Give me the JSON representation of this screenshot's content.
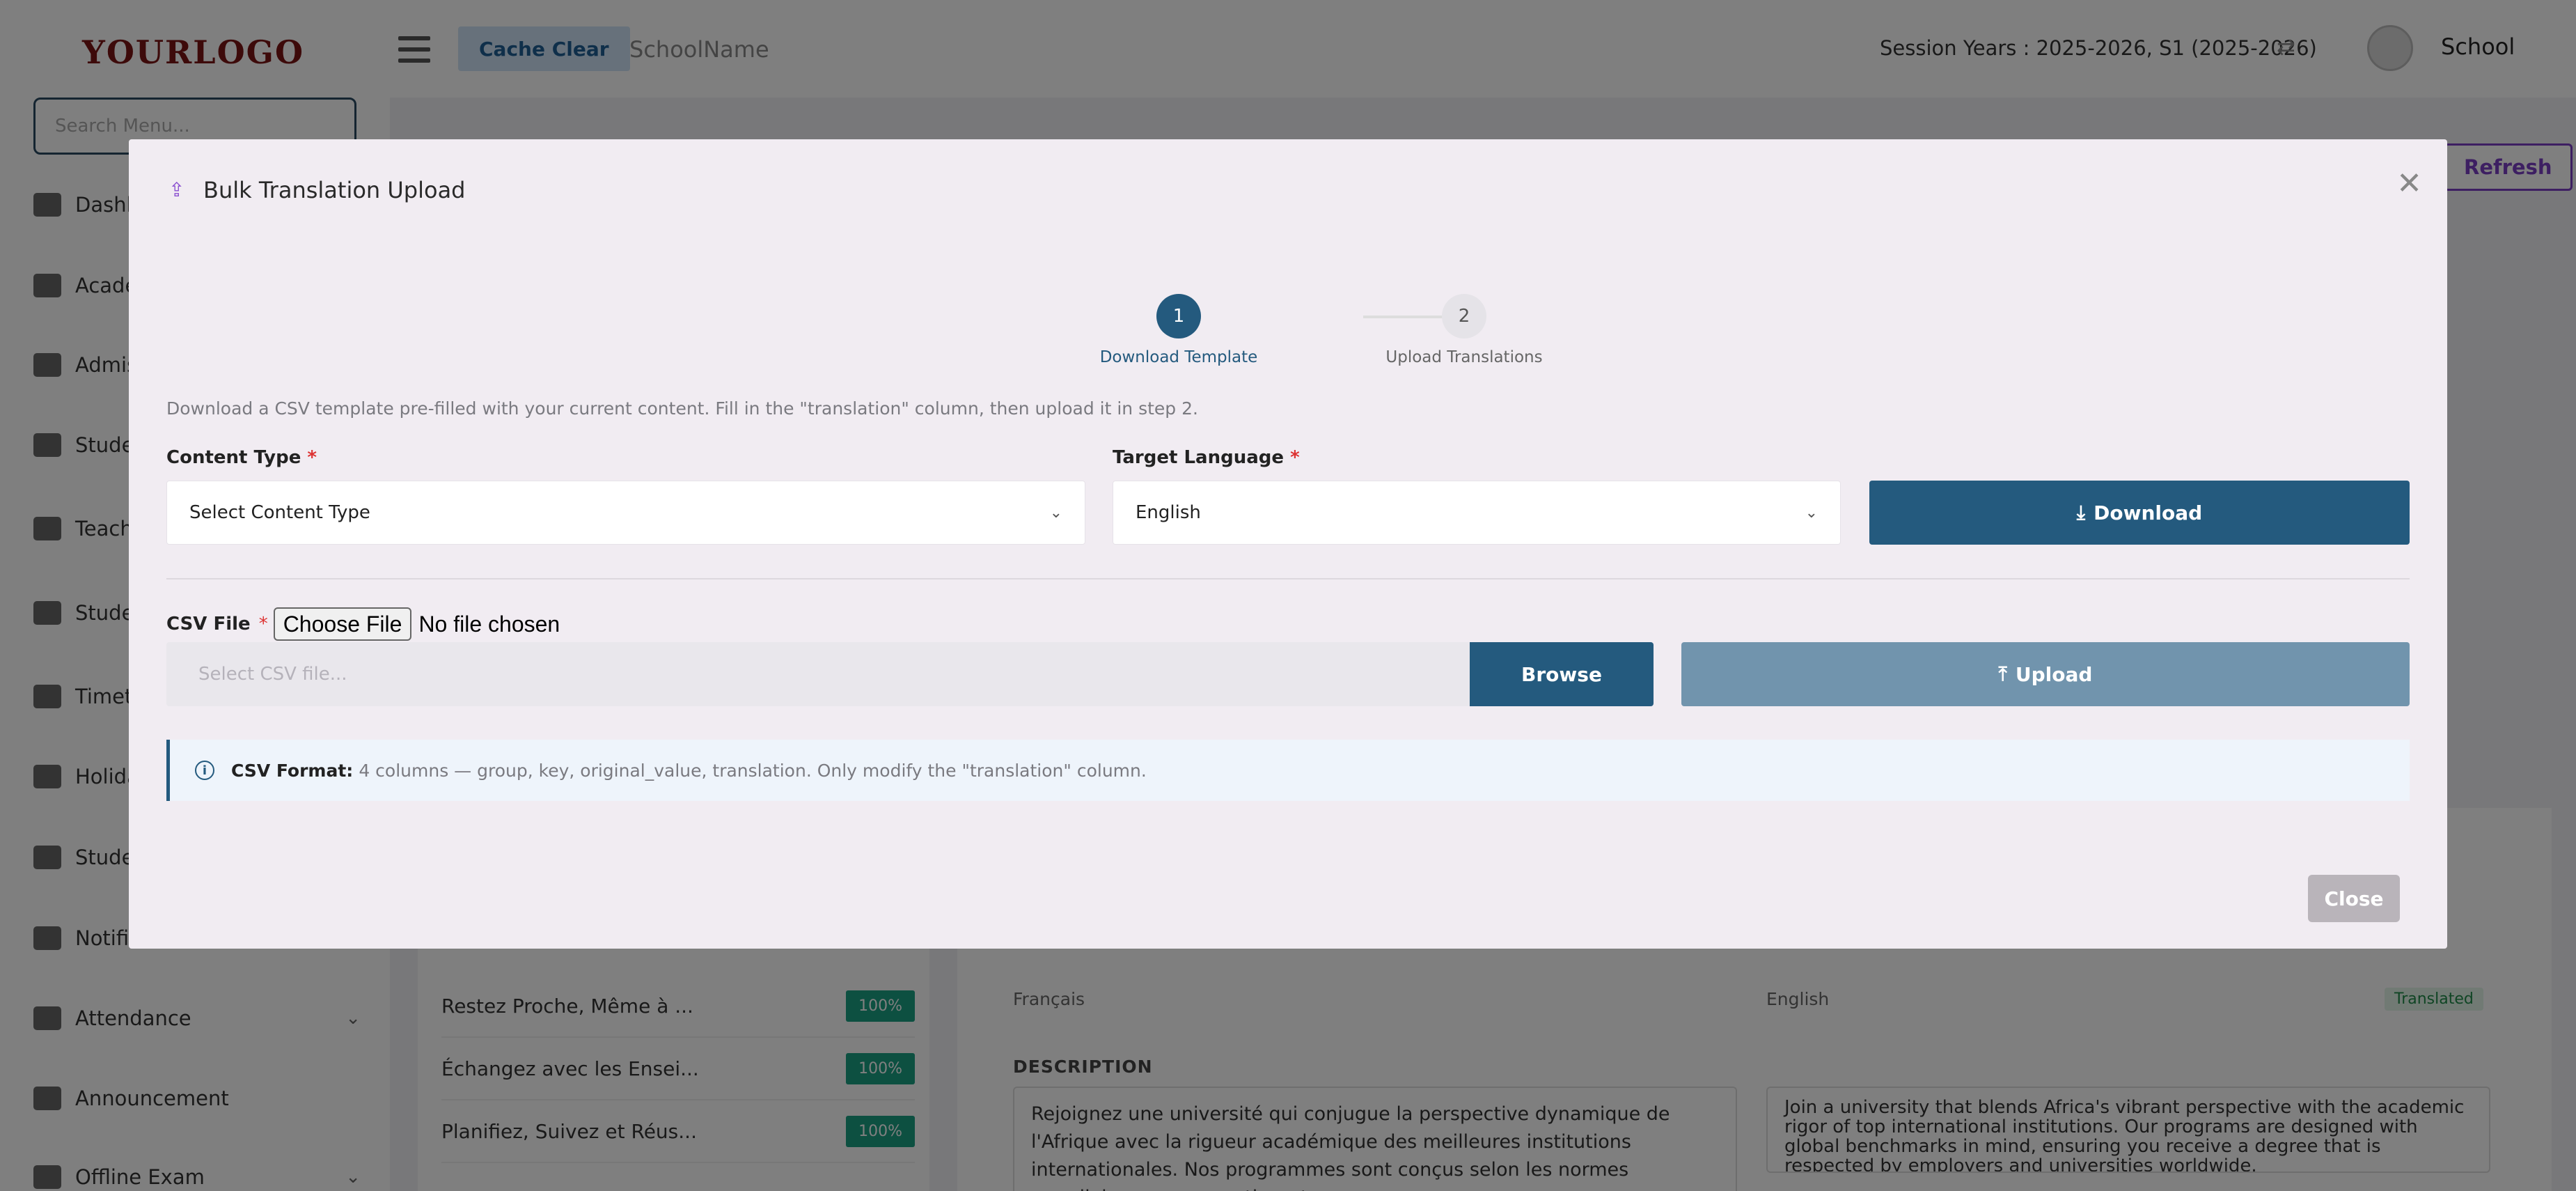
{
  "header": {
    "logo": "YOURLOGO",
    "cache_clear": "Cache Clear",
    "school_name": "SchoolName",
    "session": "Session Years : 2025-2026, S1 (2025-2026)",
    "user": "School"
  },
  "sidebar": {
    "search_placeholder": "Search Menu...",
    "items": [
      {
        "label": "Dashb"
      },
      {
        "label": "Acade"
      },
      {
        "label": "Admis"
      },
      {
        "label": "Stude"
      },
      {
        "label": "Teach"
      },
      {
        "label": "Stude"
      },
      {
        "label": "Timet"
      },
      {
        "label": "Holida"
      },
      {
        "label": "Stude"
      },
      {
        "label": "Notifi"
      },
      {
        "label": "Attendance"
      },
      {
        "label": "Announcement"
      },
      {
        "label": "Offline Exam"
      }
    ]
  },
  "background": {
    "refresh": "Refresh",
    "translated": "Translated",
    "list": [
      {
        "title": "Restez Proche, Même à ...",
        "pct": "100%"
      },
      {
        "title": "Échangez avec les Ensei...",
        "pct": "100%"
      },
      {
        "title": "Planifiez, Suivez et Réus...",
        "pct": "100%"
      }
    ],
    "lang_fr": "Français",
    "lang_en": "English",
    "description_label": "DESCRIPTION",
    "desc_fr": "Rejoignez une université qui conjugue la perspective dynamique de l'Afrique avec la rigueur académique des meilleures institutions internationales. Nos programmes sont conçus selon les normes mondiales, vous garantissant un",
    "desc_en": "Join a university that blends Africa's vibrant perspective with the academic rigor of top international institutions. Our programs are designed with global benchmarks in mind, ensuring you receive a degree that is respected by employers and universities worldwide."
  },
  "modal": {
    "title": "Bulk Translation Upload",
    "steps": [
      {
        "number": "1",
        "label": "Download Template"
      },
      {
        "number": "2",
        "label": "Upload Translations"
      }
    ],
    "instruction": "Download a CSV template pre-filled with your current content. Fill in the \"translation\" column, then upload it in step 2.",
    "content_type_label": "Content Type",
    "content_type_value": "Select Content Type",
    "target_language_label": "Target Language",
    "target_language_value": "English",
    "download": "Download",
    "csv_file_label": "CSV File",
    "choose_file": "Choose File",
    "no_file": "No file chosen",
    "csv_placeholder": "Select CSV file...",
    "browse": "Browse",
    "upload": "Upload",
    "info_strong": "CSV Format:",
    "info_text": "4 columns — group, key, original_value, translation. Only modify the \"translation\" column.",
    "close": "Close",
    "required_mark": "*"
  }
}
